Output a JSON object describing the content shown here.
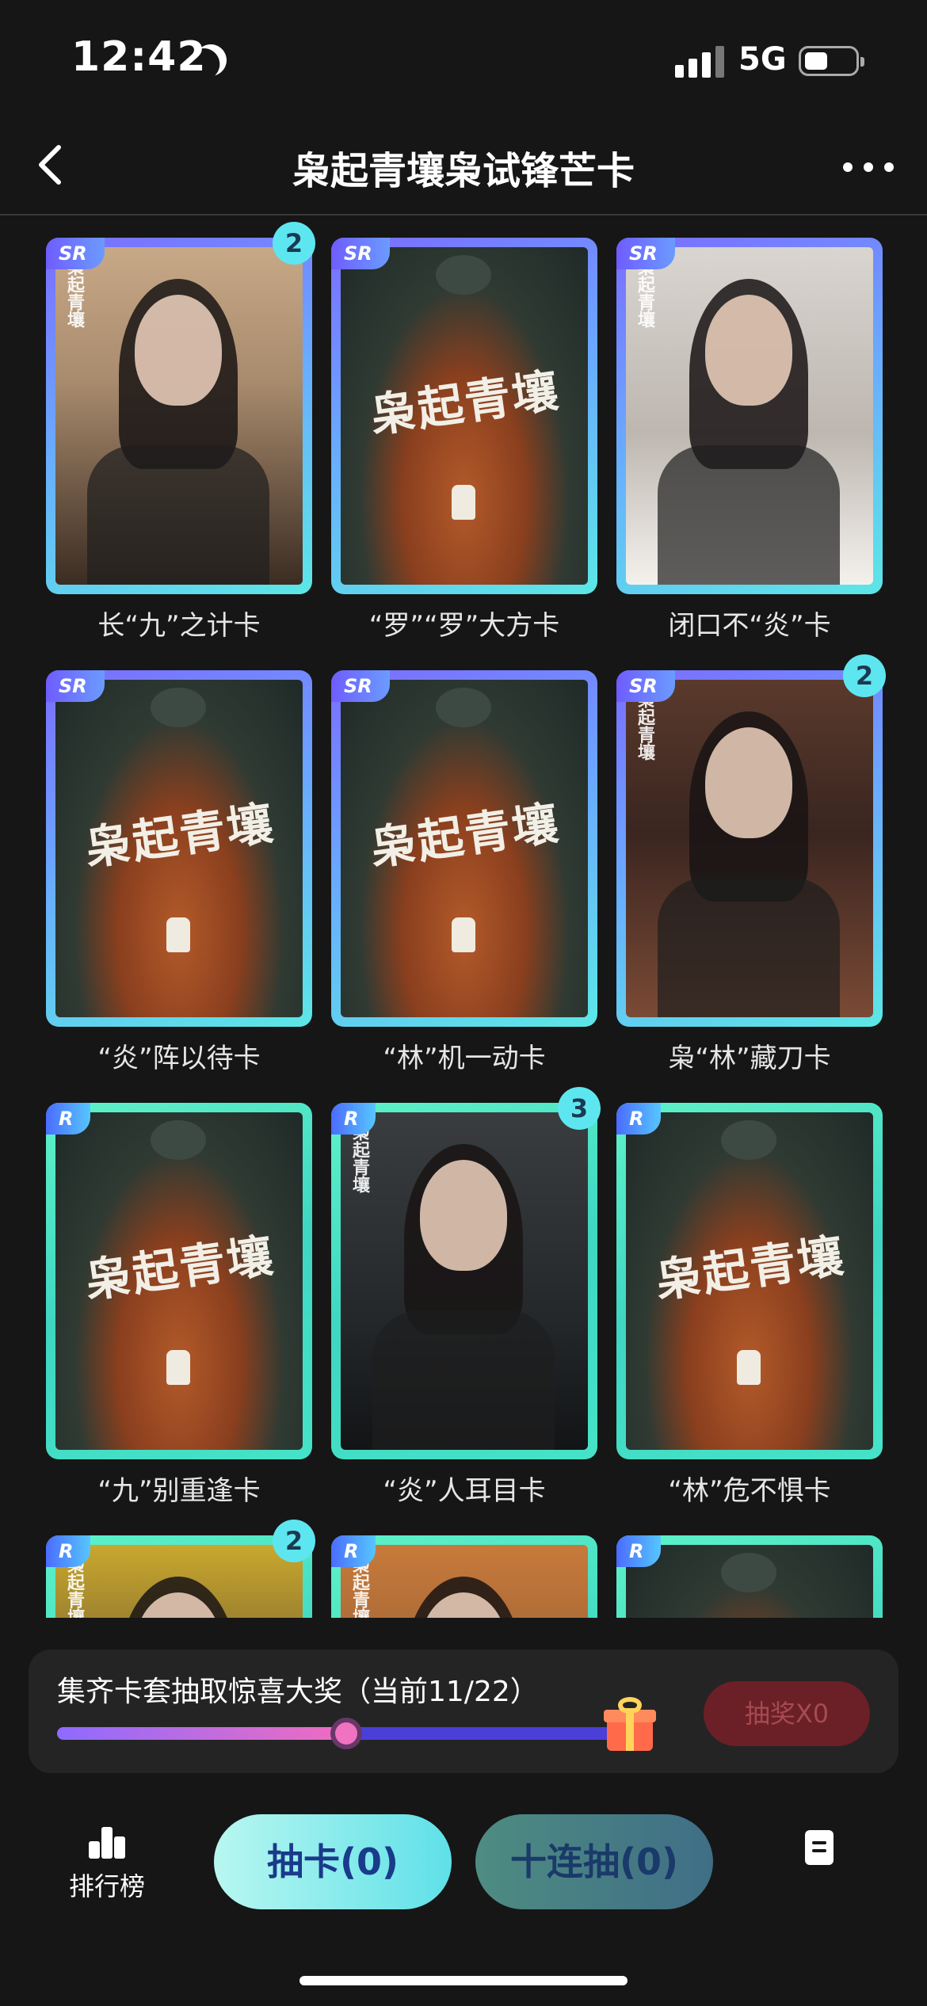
{
  "status_bar": {
    "time": "12:42",
    "network": "5G"
  },
  "nav": {
    "title": "枭起青壤枭试锋芒卡"
  },
  "cards": [
    {
      "name": "长“九”之计卡",
      "rarity": "SR",
      "count": "2",
      "art": "portrait-a"
    },
    {
      "name": "“罗”“罗”大方卡",
      "rarity": "SR",
      "count": "",
      "art": "poster"
    },
    {
      "name": "闭口不“炎”卡",
      "rarity": "SR",
      "count": "",
      "art": "portrait-b"
    },
    {
      "name": "“炎”阵以待卡",
      "rarity": "SR",
      "count": "",
      "art": "poster"
    },
    {
      "name": "“林”机一动卡",
      "rarity": "SR",
      "count": "",
      "art": "poster"
    },
    {
      "name": "枭“林”藏刀卡",
      "rarity": "SR",
      "count": "2",
      "art": "portrait-c"
    },
    {
      "name": "“九”别重逢卡",
      "rarity": "R",
      "count": "",
      "art": "poster"
    },
    {
      "name": "“炎”人耳目卡",
      "rarity": "R",
      "count": "3",
      "art": "portrait-d"
    },
    {
      "name": "“林”危不惧卡",
      "rarity": "R",
      "count": "",
      "art": "poster"
    },
    {
      "name": "",
      "rarity": "R",
      "count": "2",
      "art": "portrait-e"
    },
    {
      "name": "",
      "rarity": "R",
      "count": "",
      "art": "portrait-f"
    },
    {
      "name": "",
      "rarity": "R",
      "count": "",
      "art": "poster"
    }
  ],
  "card_watermark": "枭起青壤",
  "poster_logo": "枭起青壤",
  "progress": {
    "label": "集齐卡套抽取惊喜大奖（当前11/22）",
    "collected": 11,
    "total": 22,
    "fraction": 0.5
  },
  "draw_prize_button": "抽奖X0",
  "bottom": {
    "leaderboard_label": "排行榜",
    "draw_card_label": "抽卡(0)",
    "ten_draw_label": "十连抽(0)"
  },
  "colors": {
    "background": "#161616",
    "sr_frame": "#6aa8ff",
    "r_frame": "#46e3c7",
    "count_badge": "#5ee6f0",
    "progress_fill": "#f06cc0",
    "prize_button": "#6b1f26"
  },
  "icons": [
    "moon-icon",
    "signal-icon",
    "battery-icon",
    "back-icon",
    "more-icon",
    "gift-icon",
    "leaderboard-icon",
    "rules-icon"
  ]
}
